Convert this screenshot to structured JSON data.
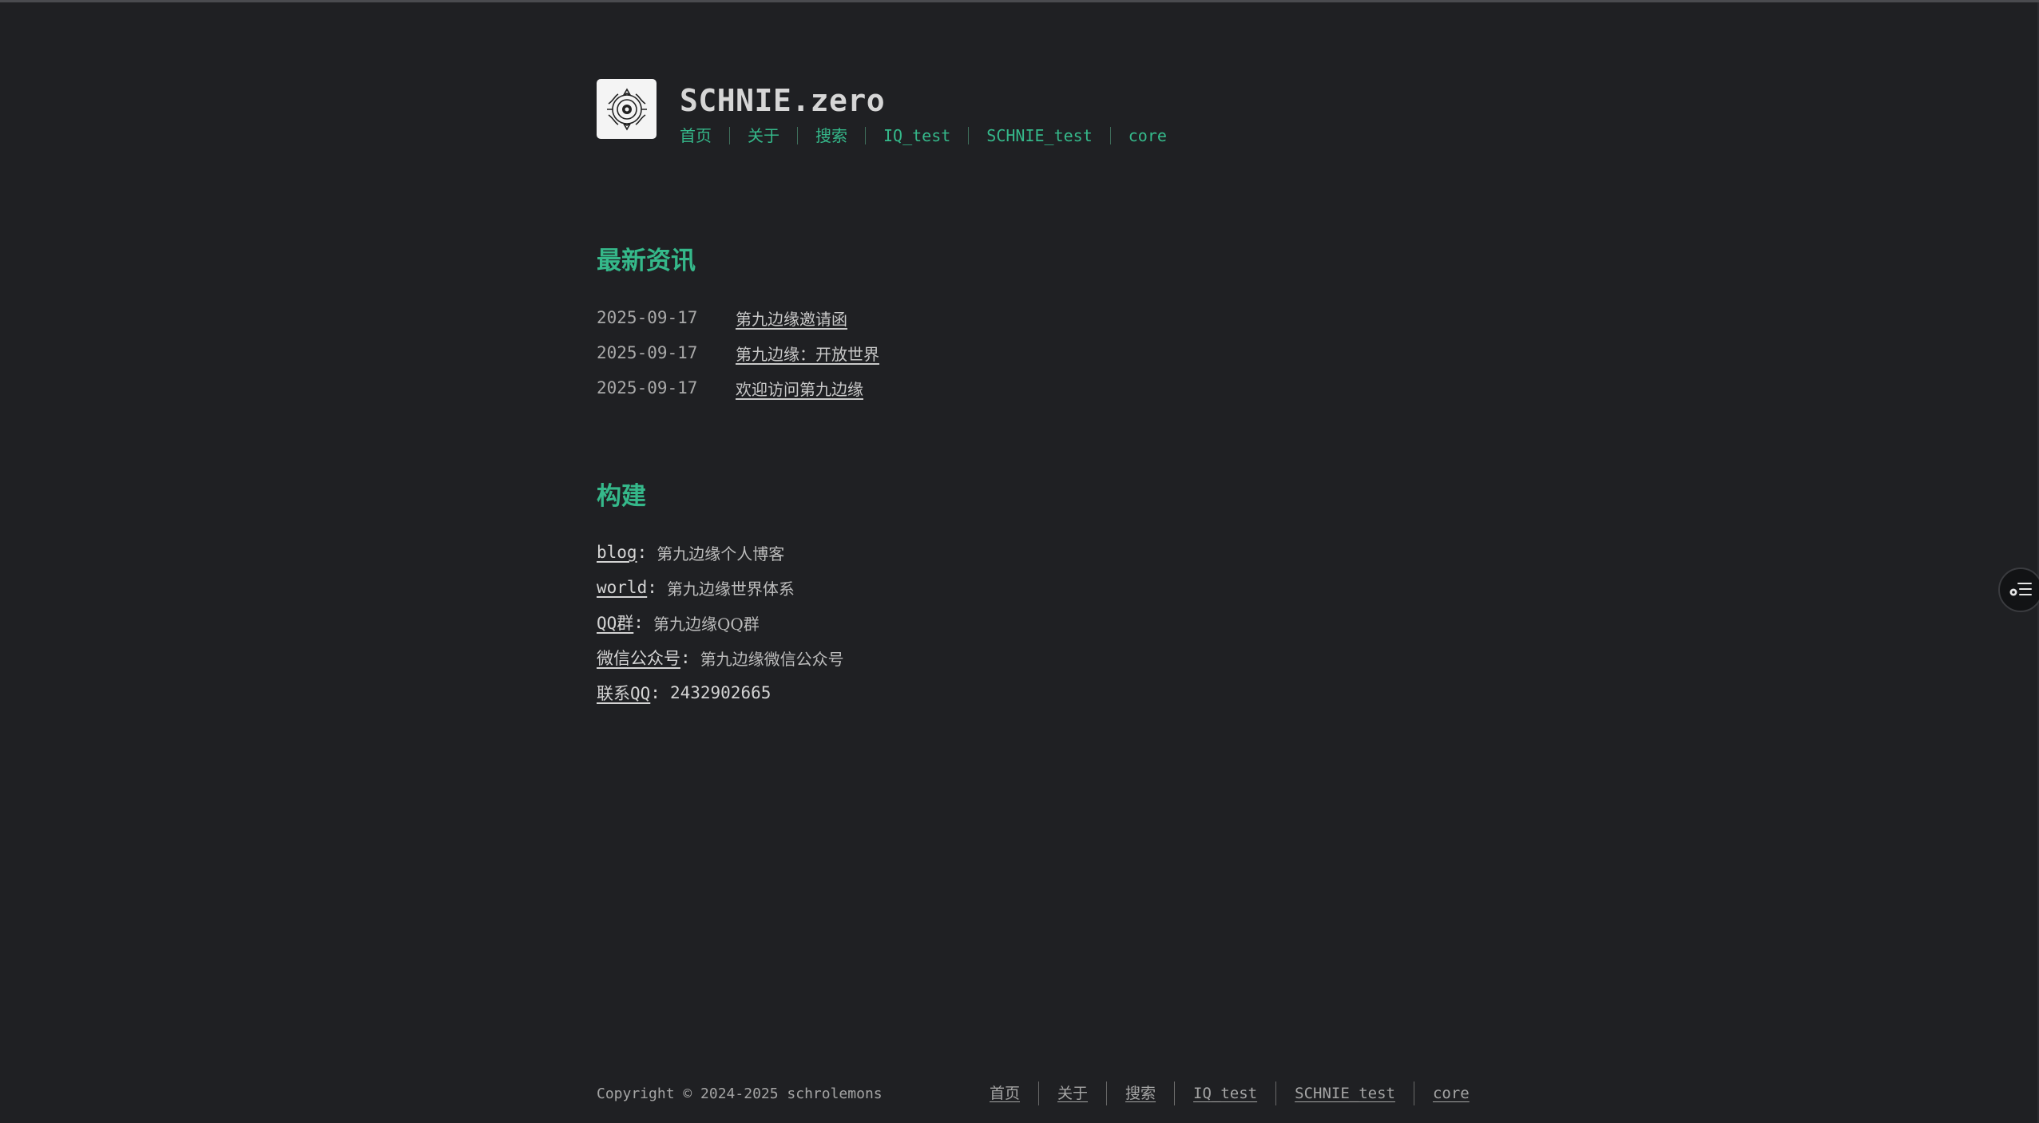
{
  "header": {
    "title": "SCHNIE.zero",
    "logo_icon": "seal-logo-icon",
    "nav": [
      "首页",
      "关于",
      "搜索",
      "IQ_test",
      "SCHNIE_test",
      "core"
    ]
  },
  "news": {
    "title": "最新资讯",
    "items": [
      {
        "date": "2025-09-17",
        "label": "第九边缘邀请函"
      },
      {
        "date": "2025-09-17",
        "label": "第九边缘：开放世界"
      },
      {
        "date": "2025-09-17",
        "label": "欢迎访问第九边缘"
      }
    ]
  },
  "build": {
    "title": "构建",
    "items": [
      {
        "link": "blog",
        "sep": ":",
        "desc": "第九边缘个人博客"
      },
      {
        "link": "world",
        "sep": ":",
        "desc": "第九边缘世界体系"
      },
      {
        "link": "QQ群",
        "sep": ":",
        "desc": "第九边缘QQ群"
      },
      {
        "link": "微信公众号",
        "sep": ":",
        "desc": "第九边缘微信公众号"
      },
      {
        "link": "联系QQ",
        "sep": ":",
        "value": "2432902665"
      }
    ]
  },
  "footer": {
    "copyright": "Copyright © 2024-2025 schrolemons",
    "nav": [
      "首页",
      "关于",
      "搜索",
      "IQ_test",
      "SCHNIE_test",
      "core"
    ]
  },
  "floating": {
    "icon": "toc-settings-icon"
  },
  "colors": {
    "background": "#1f2023",
    "accent": "#35b88a",
    "text": "#c9c9c9"
  }
}
